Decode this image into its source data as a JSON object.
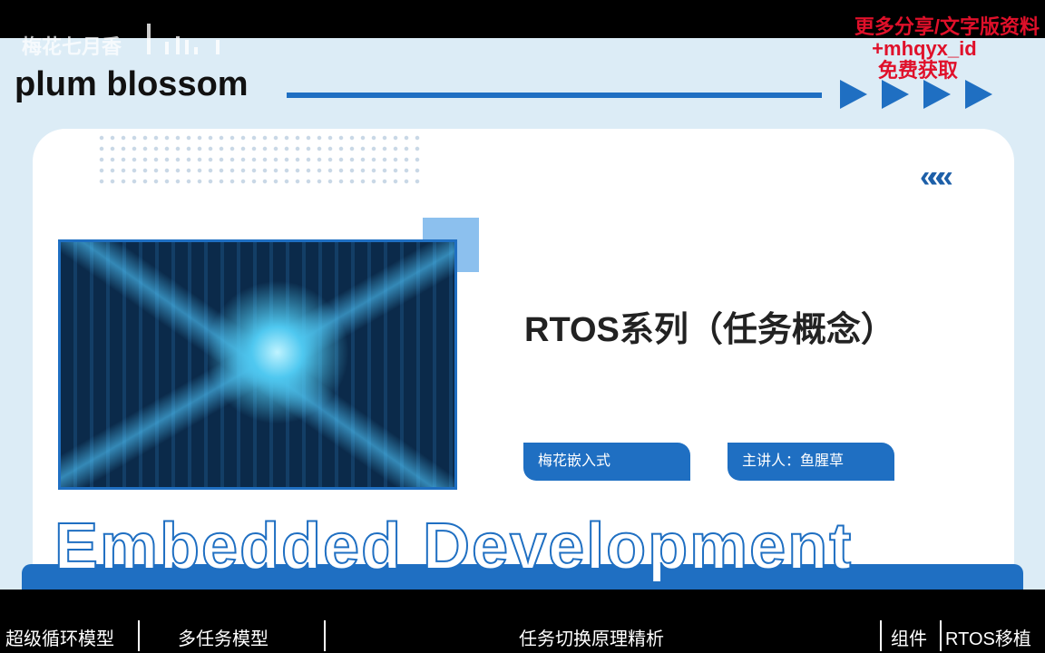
{
  "watermark": {
    "text": "梅花七月香"
  },
  "promo": {
    "line1": "更多分享/文字版资料",
    "line2": "+mhqyx_id",
    "line3": "免费获取"
  },
  "slide": {
    "brand": "plum blossom",
    "title": "RTOS系列（任务概念）",
    "tag1": "梅花嵌入式",
    "tag2": "主讲人：鱼腥草",
    "banner": "Embedded Development",
    "chevrons": "«««"
  },
  "chapters": [
    "超级循环模型",
    "多任务模型",
    "任务切换原理精析",
    "组件",
    "RTOS移植"
  ],
  "colors": {
    "accent": "#1f6fc2",
    "promo": "#e0102a"
  }
}
